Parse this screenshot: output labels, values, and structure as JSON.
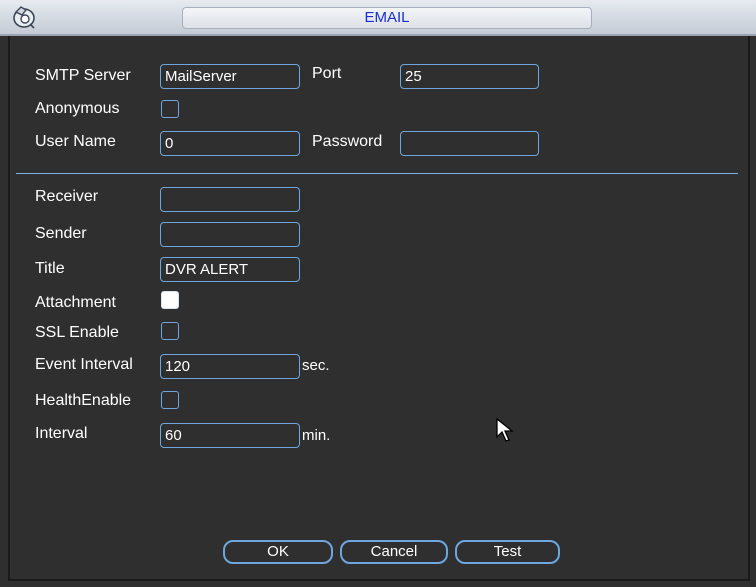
{
  "window": {
    "title": "EMAIL"
  },
  "icons": {
    "app": "dvr-camera-icon",
    "cursor": "mouse-pointer-icon"
  },
  "smtp": {
    "server_label": "SMTP Server",
    "server_value": "MailServer",
    "port_label": "Port",
    "port_value": "25",
    "anonymous_label": "Anonymous",
    "anonymous_checked": false,
    "username_label": "User Name",
    "username_value": "0",
    "password_label": "Password",
    "password_value": ""
  },
  "mail": {
    "receiver_label": "Receiver",
    "receiver_value": "",
    "sender_label": "Sender",
    "sender_value": "",
    "title_label": "Title",
    "title_value": "DVR ALERT",
    "attachment_label": "Attachment",
    "attachment_checked": true,
    "ssl_label": "SSL Enable",
    "ssl_checked": false,
    "event_interval_label": "Event Interval",
    "event_interval_value": "120",
    "event_interval_unit": "sec.",
    "health_label": "HealthEnable",
    "health_checked": false,
    "interval_label": "Interval",
    "interval_value": "60",
    "interval_unit": "min."
  },
  "buttons": {
    "ok": "OK",
    "cancel": "Cancel",
    "test": "Test"
  },
  "colors": {
    "background": "#2f2f2f",
    "accent_border": "#6fa6de",
    "title_text": "#1a2fd0",
    "text": "#ffffff"
  }
}
